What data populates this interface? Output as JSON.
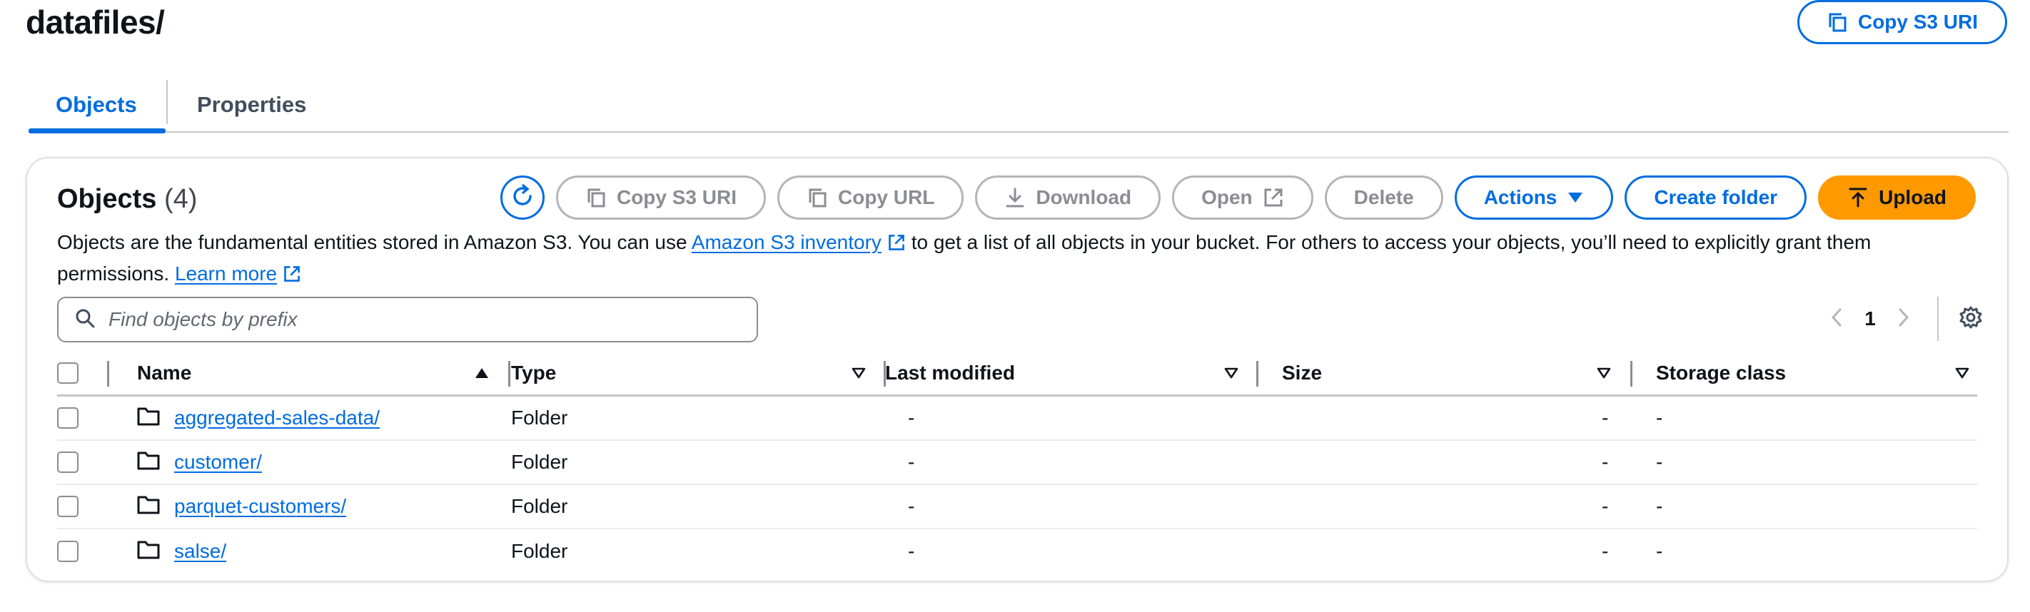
{
  "page": {
    "title": "datafiles/",
    "copy_s3_uri_label": "Copy S3 URI"
  },
  "tabs": [
    {
      "label": "Objects",
      "active": true
    },
    {
      "label": "Properties",
      "active": false
    }
  ],
  "objects_panel": {
    "heading": "Objects",
    "count": "(4)",
    "toolbar": {
      "copy_s3_uri": "Copy S3 URI",
      "copy_url": "Copy URL",
      "download": "Download",
      "open": "Open",
      "delete": "Delete",
      "actions": "Actions",
      "create_folder": "Create folder",
      "upload": "Upload"
    },
    "description": {
      "part1": "Objects are the fundamental entities stored in Amazon S3. You can use ",
      "link_inventory": "Amazon S3 inventory",
      "part2": " to get a list of all objects in your bucket. For others to access your objects, you’ll need to explicitly grant them permissions. ",
      "link_learn_more": "Learn more"
    },
    "search": {
      "placeholder": "Find objects by prefix",
      "value": ""
    },
    "pagination": {
      "current_page": "1"
    }
  },
  "table": {
    "columns": [
      "Name",
      "Type",
      "Last modified",
      "Size",
      "Storage class"
    ],
    "sort": {
      "column": "Name",
      "direction": "ascending"
    },
    "rows": [
      {
        "name": "aggregated-sales-data/",
        "type": "Folder",
        "last_modified": "-",
        "size": "-",
        "storage_class": "-"
      },
      {
        "name": "customer/",
        "type": "Folder",
        "last_modified": "-",
        "size": "-",
        "storage_class": "-"
      },
      {
        "name": "parquet-customers/",
        "type": "Folder",
        "last_modified": "-",
        "size": "-",
        "storage_class": "-"
      },
      {
        "name": "salse/",
        "type": "Folder",
        "last_modified": "-",
        "size": "-",
        "storage_class": "-"
      }
    ]
  },
  "colors": {
    "accent": "#006ce0",
    "primary_button": "#ff9900",
    "disabled": "#8c8c94",
    "border": "#c6c6cd"
  },
  "icons": [
    "copy-icon",
    "refresh-icon",
    "download-icon",
    "external-link-icon",
    "caret-down-icon",
    "upload-icon",
    "search-icon",
    "chevron-left-icon",
    "chevron-right-icon",
    "settings-icon",
    "sort-ascending-icon",
    "sort-icon",
    "folder-icon"
  ]
}
